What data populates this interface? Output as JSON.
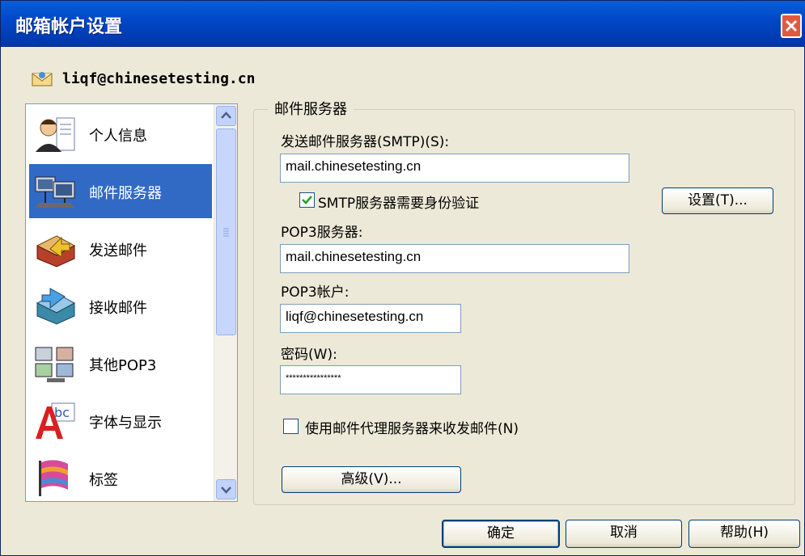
{
  "window": {
    "title": "邮箱帐户设置"
  },
  "account": {
    "email": "liqf@chinesetesting.cn",
    "icon": "envelope-icon"
  },
  "sidebar": {
    "items": [
      {
        "label": "个人信息",
        "icon": "person-icon"
      },
      {
        "label": "邮件服务器",
        "icon": "server-icon"
      },
      {
        "label": "发送邮件",
        "icon": "send-mail-icon"
      },
      {
        "label": "接收邮件",
        "icon": "receive-mail-icon"
      },
      {
        "label": "其他POP3",
        "icon": "other-pop3-icon"
      },
      {
        "label": "字体与显示",
        "icon": "font-display-icon"
      },
      {
        "label": "标签",
        "icon": "label-icon"
      }
    ],
    "selected_index": 1
  },
  "mail_server": {
    "group_title": "邮件服务器",
    "smtp_label": "发送邮件服务器(SMTP)(S):",
    "smtp_value": "mail.chinesetesting.cn",
    "smtp_auth_label": "SMTP服务器需要身份验证",
    "smtp_auth_checked": true,
    "settings_button": "设置(T)...",
    "pop3_label": "POP3服务器:",
    "pop3_value": "mail.chinesetesting.cn",
    "account_label": "POP3帐户:",
    "account_value": "liqf@chinesetesting.cn",
    "password_label": "密码(W):",
    "password_value": "****************",
    "proxy_label": "使用邮件代理服务器来收发邮件(N)",
    "proxy_checked": false,
    "advanced_button": "高级(V)..."
  },
  "footer": {
    "ok": "确定",
    "cancel": "取消",
    "help": "帮助(H)"
  },
  "colors": {
    "title_bar": "#0048c8",
    "selection": "#316ac5",
    "dialog_bg": "#ece9d8"
  }
}
